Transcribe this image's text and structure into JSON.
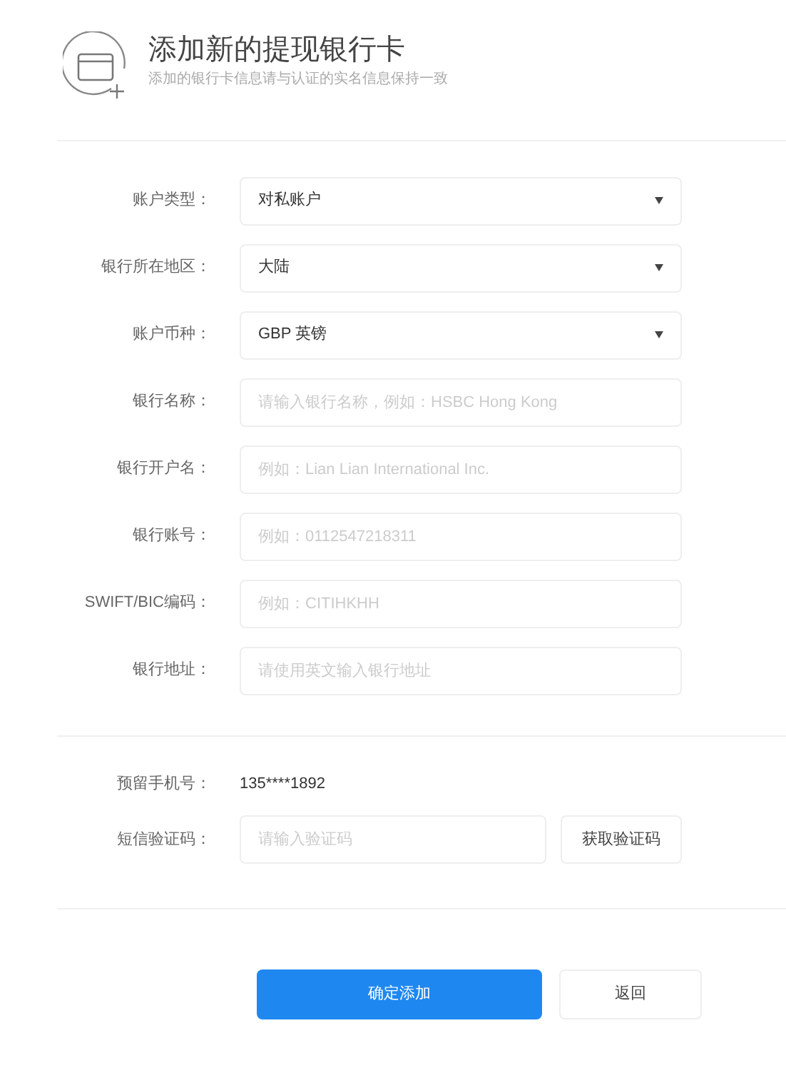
{
  "header": {
    "title": "添加新的提现银行卡",
    "subtitle": "添加的银行卡信息请与认证的实名信息保持一致"
  },
  "fields": [
    {
      "kind": "select",
      "label": "账户类型：",
      "value": "对私账户"
    },
    {
      "kind": "select",
      "label": "银行所在地区：",
      "value": "大陆"
    },
    {
      "kind": "select",
      "label": "账户币种：",
      "value": "GBP 英镑"
    },
    {
      "kind": "input",
      "label": "银行名称：",
      "placeholder": "请输入银行名称，例如：HSBC Hong Kong"
    },
    {
      "kind": "input",
      "label": "银行开户名：",
      "placeholder": "例如：Lian Lian International Inc."
    },
    {
      "kind": "input",
      "label": "银行账号：",
      "placeholder": "例如：0112547218311"
    },
    {
      "kind": "input",
      "label": "SWIFT/BIC编码：",
      "placeholder": "例如：CITIHKHH"
    },
    {
      "kind": "input",
      "label": "银行地址：",
      "placeholder": "请使用英文输入银行地址"
    }
  ],
  "verification": {
    "phone_label": "预留手机号：",
    "phone": "135****1892",
    "sms_label": "短信验证码：",
    "sms_placeholder": "请输入验证码",
    "sms_button": "获取验证码"
  },
  "buttons": {
    "confirm": "确定添加",
    "back": "返回"
  }
}
